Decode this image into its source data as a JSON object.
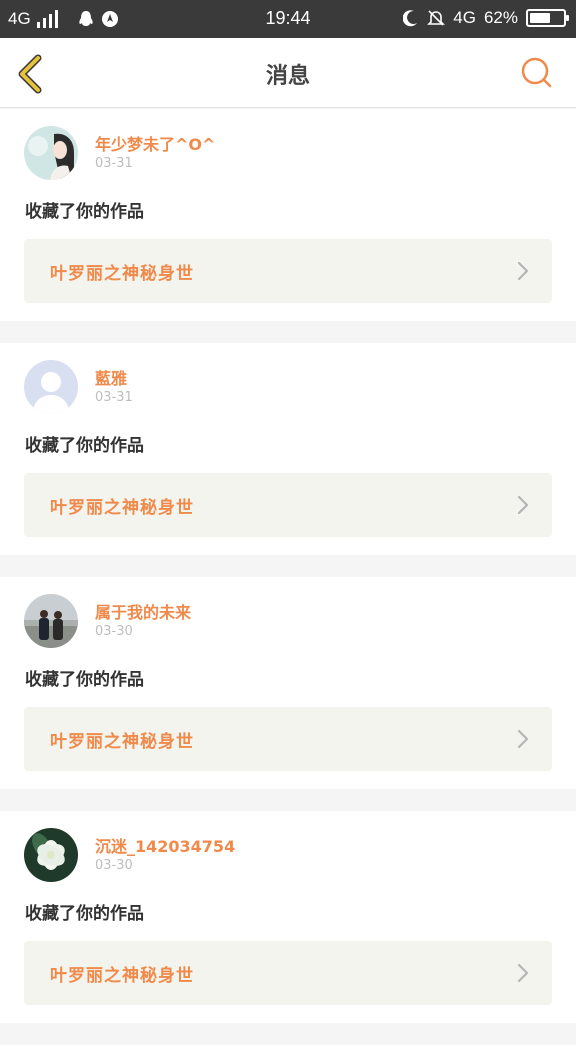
{
  "status_bar": {
    "network_left": "4G",
    "time": "19:44",
    "network_right": "4G",
    "battery_text": "62%",
    "battery_level": 0.62
  },
  "nav": {
    "title": "消息"
  },
  "colors": {
    "accent": "#f08a4b",
    "back_icon": "#e8c23a",
    "status_bar_bg": "#3a3a3a",
    "work_box_bg": "#f4f4ee"
  },
  "messages": [
    {
      "user_name": "年少梦未了^O^",
      "date": "03-31",
      "action": "收藏了你的作品",
      "work_title": "叶罗丽之神秘身世",
      "avatar": "anime-girl-avatar"
    },
    {
      "user_name": "藍雅",
      "date": "03-31",
      "action": "收藏了你的作品",
      "work_title": "叶罗丽之神秘身世",
      "avatar": "default-avatar"
    },
    {
      "user_name": "属于我的未来",
      "date": "03-30",
      "action": "收藏了你的作品",
      "work_title": "叶罗丽之神秘身世",
      "avatar": "couple-photo-avatar"
    },
    {
      "user_name": "沉迷_142034754",
      "date": "03-30",
      "action": "收藏了你的作品",
      "work_title": "叶罗丽之神秘身世",
      "avatar": "flower-avatar"
    }
  ]
}
